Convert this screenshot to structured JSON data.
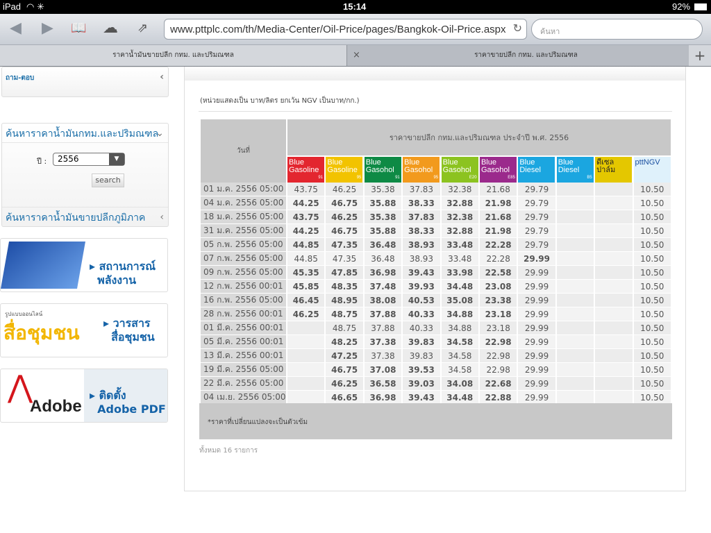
{
  "status": {
    "device": "iPad",
    "time": "15:14",
    "battery": "92%"
  },
  "browser": {
    "url": "www.pttplc.com/th/Media-Center/Oil-Price/pages/Bangkok-Oil-Price.aspx",
    "search_placeholder": "ค้นหา",
    "tabs": [
      {
        "label": "ราคาน้ำมันขายปลีก กทม. และปริมณฑล"
      },
      {
        "label": "ราคาขายปลีก กทม. และปริมณฑล"
      }
    ]
  },
  "sidebar": {
    "faq": "ถาม-ตอบ",
    "search_box_title": "ค้นหาราคาน้ำมันกทม.และปริมณฑล",
    "year_label": "ปี :",
    "year_value": "2556",
    "search_button": "search",
    "regional_title": "ค้นหาราคาน้ำมันขายปลีกภูมิภาค",
    "banners": [
      {
        "line1": "สถานการณ์",
        "line2": "พลังงาน"
      },
      {
        "logo": "สื่อชุมชน",
        "small": "รูปแบบออนไลน์",
        "line1": "วารสาร",
        "line2": "สื่อชุมชน"
      },
      {
        "logo": "Adobe",
        "line1": "ติดตั้ง",
        "line2": "Adobe PDF"
      }
    ]
  },
  "main": {
    "unit_note": "(หน่วยแสดงเป็น บาท/ลิตร ยกเว้น NGV เป็นบาท/กก.)",
    "date_header": "วันที่",
    "group_header": "ราคาขายปลีก กทม.และปริมณฑล ประจำปี พ.ศ. 2556",
    "fuels": [
      {
        "l1": "Blue",
        "l2": "Gasoline",
        "sub": "91",
        "color": "#e3262f"
      },
      {
        "l1": "Blue",
        "l2": "Gasoline",
        "sub": "95",
        "color": "#f2c300"
      },
      {
        "l1": "Blue",
        "l2": "Gasohol",
        "sub": "91",
        "color": "#0e8a45"
      },
      {
        "l1": "Blue",
        "l2": "Gasohol",
        "sub": "95",
        "color": "#f29a1d"
      },
      {
        "l1": "Blue",
        "l2": "Gasohol",
        "sub": "E20",
        "color": "#8cc320"
      },
      {
        "l1": "Blue",
        "l2": "Gasohol",
        "sub": "E85",
        "color": "#9b2a8c"
      },
      {
        "l1": "Blue",
        "l2": "Diesel",
        "sub": "",
        "color": "#1ba6e0"
      },
      {
        "l1": "Blue",
        "l2": "Diesel",
        "sub": "B5",
        "color": "#1ba6e0"
      },
      {
        "l1": "ดีเซล",
        "l2": "ปาล์ม",
        "sub": "",
        "color": "#e4c700"
      },
      {
        "l1": "pttNGV",
        "l2": "",
        "sub": "",
        "color": "#dff1fb"
      }
    ],
    "rows": [
      {
        "date": "01 ม.ค. 2556 05:00",
        "v": [
          "43.75",
          "46.25",
          "35.38",
          "37.83",
          "32.38",
          "21.68",
          "29.79",
          "",
          "",
          "10.50"
        ],
        "b": []
      },
      {
        "date": "04 ม.ค. 2556 05:00",
        "v": [
          "44.25",
          "46.75",
          "35.88",
          "38.33",
          "32.88",
          "21.98",
          "29.79",
          "",
          "",
          "10.50"
        ],
        "b": [
          0,
          1,
          2,
          3,
          4,
          5
        ]
      },
      {
        "date": "18 ม.ค. 2556 05:00",
        "v": [
          "43.75",
          "46.25",
          "35.38",
          "37.83",
          "32.38",
          "21.68",
          "29.79",
          "",
          "",
          "10.50"
        ],
        "b": [
          0,
          1,
          2,
          3,
          4,
          5
        ]
      },
      {
        "date": "31 ม.ค. 2556 05:00",
        "v": [
          "44.25",
          "46.75",
          "35.88",
          "38.33",
          "32.88",
          "21.98",
          "29.79",
          "",
          "",
          "10.50"
        ],
        "b": [
          0,
          1,
          2,
          3,
          4,
          5
        ]
      },
      {
        "date": "05 ก.พ. 2556 05:00",
        "v": [
          "44.85",
          "47.35",
          "36.48",
          "38.93",
          "33.48",
          "22.28",
          "29.79",
          "",
          "",
          "10.50"
        ],
        "b": [
          0,
          1,
          2,
          3,
          4,
          5
        ]
      },
      {
        "date": "07 ก.พ. 2556 05:00",
        "v": [
          "44.85",
          "47.35",
          "36.48",
          "38.93",
          "33.48",
          "22.28",
          "29.99",
          "",
          "",
          "10.50"
        ],
        "b": [
          6
        ]
      },
      {
        "date": "09 ก.พ. 2556 05:00",
        "v": [
          "45.35",
          "47.85",
          "36.98",
          "39.43",
          "33.98",
          "22.58",
          "29.99",
          "",
          "",
          "10.50"
        ],
        "b": [
          0,
          1,
          2,
          3,
          4,
          5
        ]
      },
      {
        "date": "12 ก.พ. 2556 00:01",
        "v": [
          "45.85",
          "48.35",
          "37.48",
          "39.93",
          "34.48",
          "23.08",
          "29.99",
          "",
          "",
          "10.50"
        ],
        "b": [
          0,
          1,
          2,
          3,
          4,
          5
        ]
      },
      {
        "date": "16 ก.พ. 2556 05:00",
        "v": [
          "46.45",
          "48.95",
          "38.08",
          "40.53",
          "35.08",
          "23.38",
          "29.99",
          "",
          "",
          "10.50"
        ],
        "b": [
          0,
          1,
          2,
          3,
          4,
          5
        ]
      },
      {
        "date": "28 ก.พ. 2556 00:01",
        "v": [
          "46.25",
          "48.75",
          "37.88",
          "40.33",
          "34.88",
          "23.18",
          "29.99",
          "",
          "",
          "10.50"
        ],
        "b": [
          0,
          1,
          2,
          3,
          4,
          5
        ]
      },
      {
        "date": "01 มี.ค. 2556 00:01",
        "v": [
          "",
          "48.75",
          "37.88",
          "40.33",
          "34.88",
          "23.18",
          "29.99",
          "",
          "",
          "10.50"
        ],
        "b": []
      },
      {
        "date": "05 มี.ค. 2556 00:01",
        "v": [
          "",
          "48.25",
          "37.38",
          "39.83",
          "34.58",
          "22.98",
          "29.99",
          "",
          "",
          "10.50"
        ],
        "b": [
          1,
          2,
          3,
          4,
          5
        ]
      },
      {
        "date": "13 มี.ค. 2556 00:01",
        "v": [
          "",
          "47.25",
          "37.38",
          "39.83",
          "34.58",
          "22.98",
          "29.99",
          "",
          "",
          "10.50"
        ],
        "b": [
          1
        ]
      },
      {
        "date": "19 มี.ค. 2556 05:00",
        "v": [
          "",
          "46.75",
          "37.08",
          "39.53",
          "34.58",
          "22.98",
          "29.99",
          "",
          "",
          "10.50"
        ],
        "b": [
          1,
          2,
          3
        ]
      },
      {
        "date": "22 มี.ค. 2556 05:00",
        "v": [
          "",
          "46.25",
          "36.58",
          "39.03",
          "34.08",
          "22.68",
          "29.99",
          "",
          "",
          "10.50"
        ],
        "b": [
          1,
          2,
          3,
          4,
          5
        ]
      },
      {
        "date": "04 เม.ย. 2556 05:00",
        "v": [
          "",
          "46.65",
          "36.98",
          "39.43",
          "34.48",
          "22.88",
          "29.99",
          "",
          "",
          "10.50"
        ],
        "b": [
          1,
          2,
          3,
          4,
          5
        ]
      }
    ],
    "footnote": "*ราคาที่เปลี่ยนแปลงจะเป็นตัวเข้ม",
    "total": "ทั้งหมด 16 รายการ"
  }
}
